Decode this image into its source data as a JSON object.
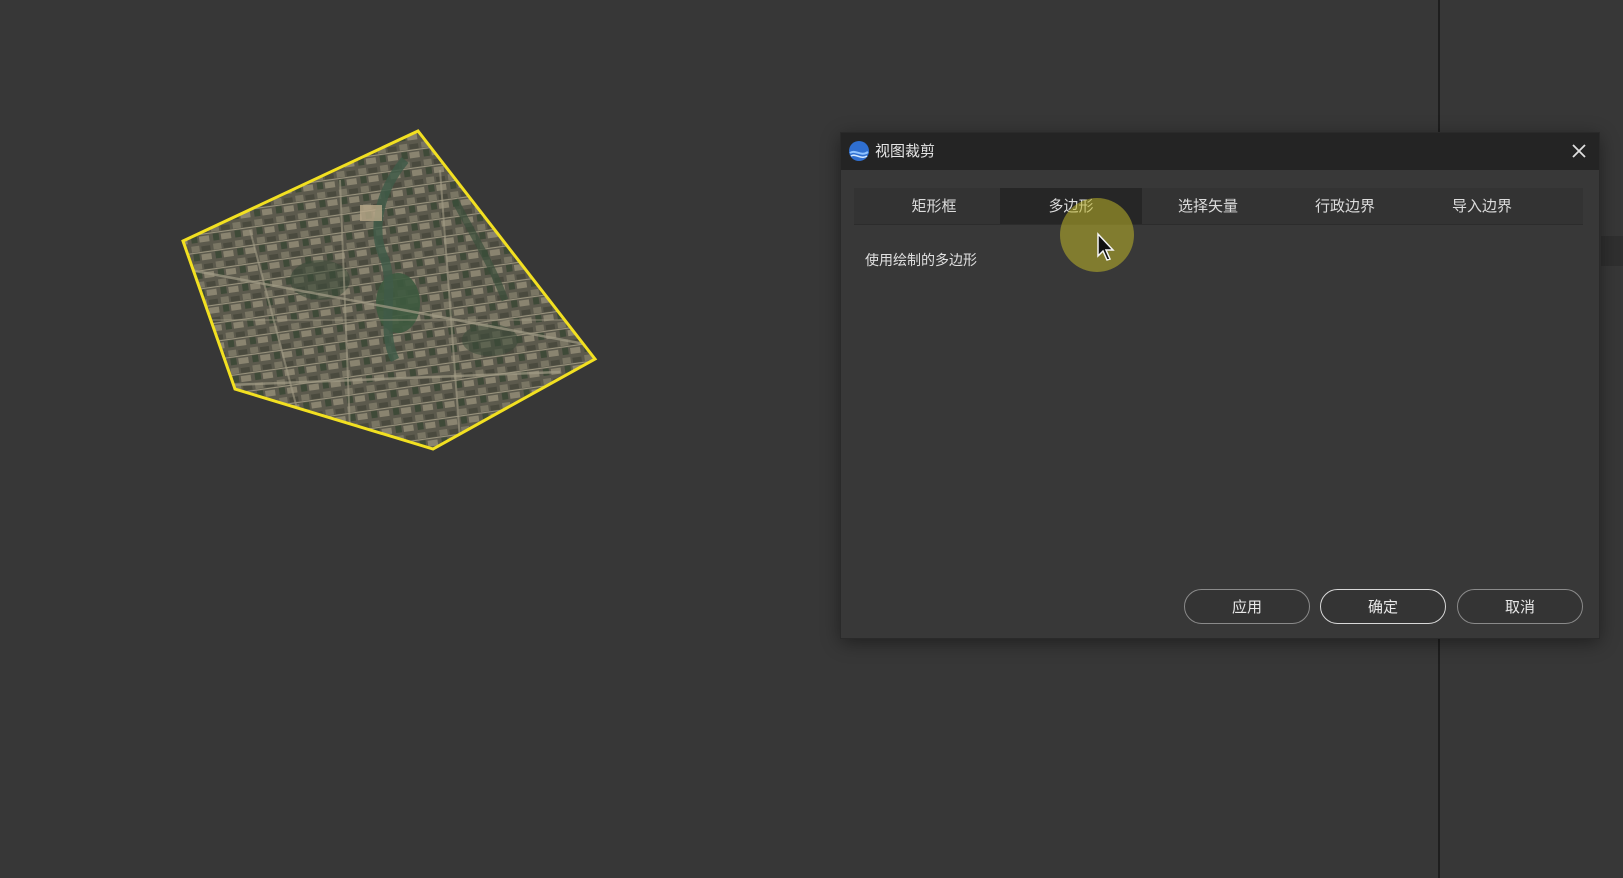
{
  "dialog": {
    "title": "视图裁剪",
    "tabs": [
      {
        "label": "矩形框",
        "active": false
      },
      {
        "label": "多边形",
        "active": true
      },
      {
        "label": "选择矢量",
        "active": false
      },
      {
        "label": "行政边界",
        "active": false
      },
      {
        "label": "导入边界",
        "active": false
      }
    ],
    "description": "使用绘制的多边形",
    "buttons": {
      "apply": "应用",
      "ok": "确定",
      "cancel": "取消"
    }
  },
  "colors": {
    "background": "#373737",
    "polygon_outline": "#f2e021",
    "dialog_bg": "#383838",
    "titlebar_bg": "#242424",
    "active_tab_bg": "#262626",
    "cursor_highlight": "#beb428"
  },
  "icons": {
    "app": "globe-app-icon",
    "close": "close-icon",
    "cursor": "mouse-pointer-icon"
  }
}
